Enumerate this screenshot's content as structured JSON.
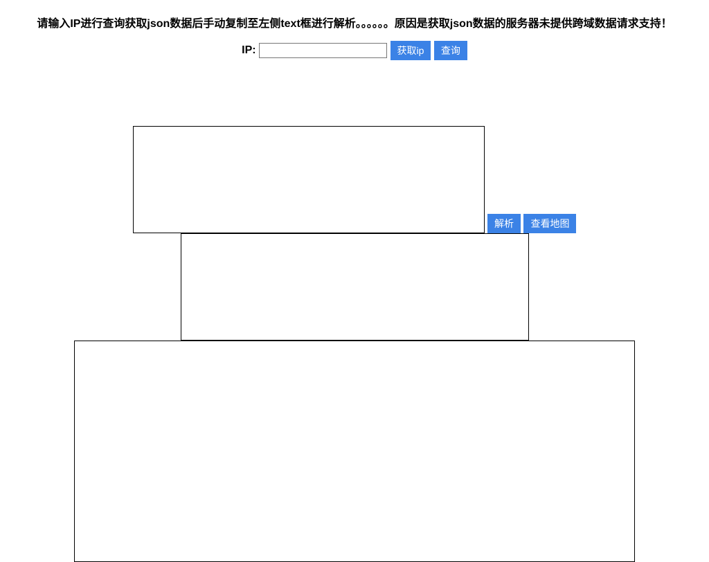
{
  "header": {
    "instruction": "请输入IP进行查询获取json数据后手动复制至左侧text框进行解析。。。。。。原因是获取json数据的服务器未提供跨域数据请求支持！"
  },
  "ipRow": {
    "label": "IP:",
    "input_value": "",
    "get_ip_label": "获取ip",
    "query_label": "查询"
  },
  "jsonArea": {
    "textarea_value": "",
    "parse_label": "解析",
    "view_map_label": "查看地图"
  },
  "resultArea": {
    "textarea_value": ""
  }
}
